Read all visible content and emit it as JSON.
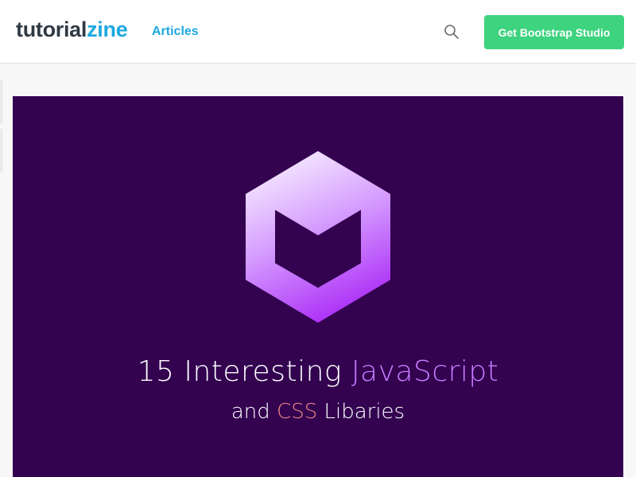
{
  "header": {
    "logo_part1": "tutorial",
    "logo_part2": "zine",
    "nav_articles": "Articles",
    "cta_label": "Get Bootstrap Studio",
    "search_icon": "search-icon"
  },
  "hero": {
    "title_part1": "15 Interesting ",
    "title_highlight": "JavaScript",
    "subtitle_part1": "and ",
    "subtitle_highlight": "CSS",
    "subtitle_part2": " Libaries",
    "logo_icon": "hexagon-logo-icon"
  },
  "colors": {
    "header_bg": "#ffffff",
    "brand_blue": "#1da8df",
    "cta_green": "#3ed37f",
    "hero_bg": "#330350",
    "accent_purple": "#c87cff",
    "accent_coral": "#f08a86"
  }
}
